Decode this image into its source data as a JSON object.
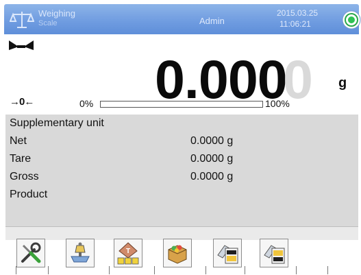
{
  "header": {
    "title": "Weighing",
    "subtitle": "Scale",
    "user": "Admin",
    "date": "2015.03.25",
    "time": "11:06:21",
    "logo_icon": "scale-logo-icon",
    "power_icon": "power-icon",
    "bg_color": "#6e9be0"
  },
  "display": {
    "weight_main": "0.000",
    "weight_last_digit": "0",
    "unit": "g",
    "stable_icon": "stability-marker-icon",
    "zero_indicator": "→0←",
    "bar_min_label": "0%",
    "bar_max_label": "100%",
    "bar_level_percent": 0
  },
  "info": {
    "rows": [
      {
        "label": "Supplementary unit",
        "value": ""
      },
      {
        "label": "Net",
        "value": "0.0000 g"
      },
      {
        "label": "Tare",
        "value": "0.0000 g"
      },
      {
        "label": "Gross",
        "value": "0.0000 g"
      },
      {
        "label": "Product",
        "value": ""
      }
    ]
  },
  "toolbar": {
    "buttons": [
      {
        "icon": "tools-wrench-screwdriver-icon"
      },
      {
        "icon": "weight-on-scale-icon"
      },
      {
        "icon": "tare-keypad-icon"
      },
      {
        "icon": "product-box-icon"
      },
      {
        "icon": "print-header-icon"
      },
      {
        "icon": "print-footer-icon"
      }
    ]
  }
}
